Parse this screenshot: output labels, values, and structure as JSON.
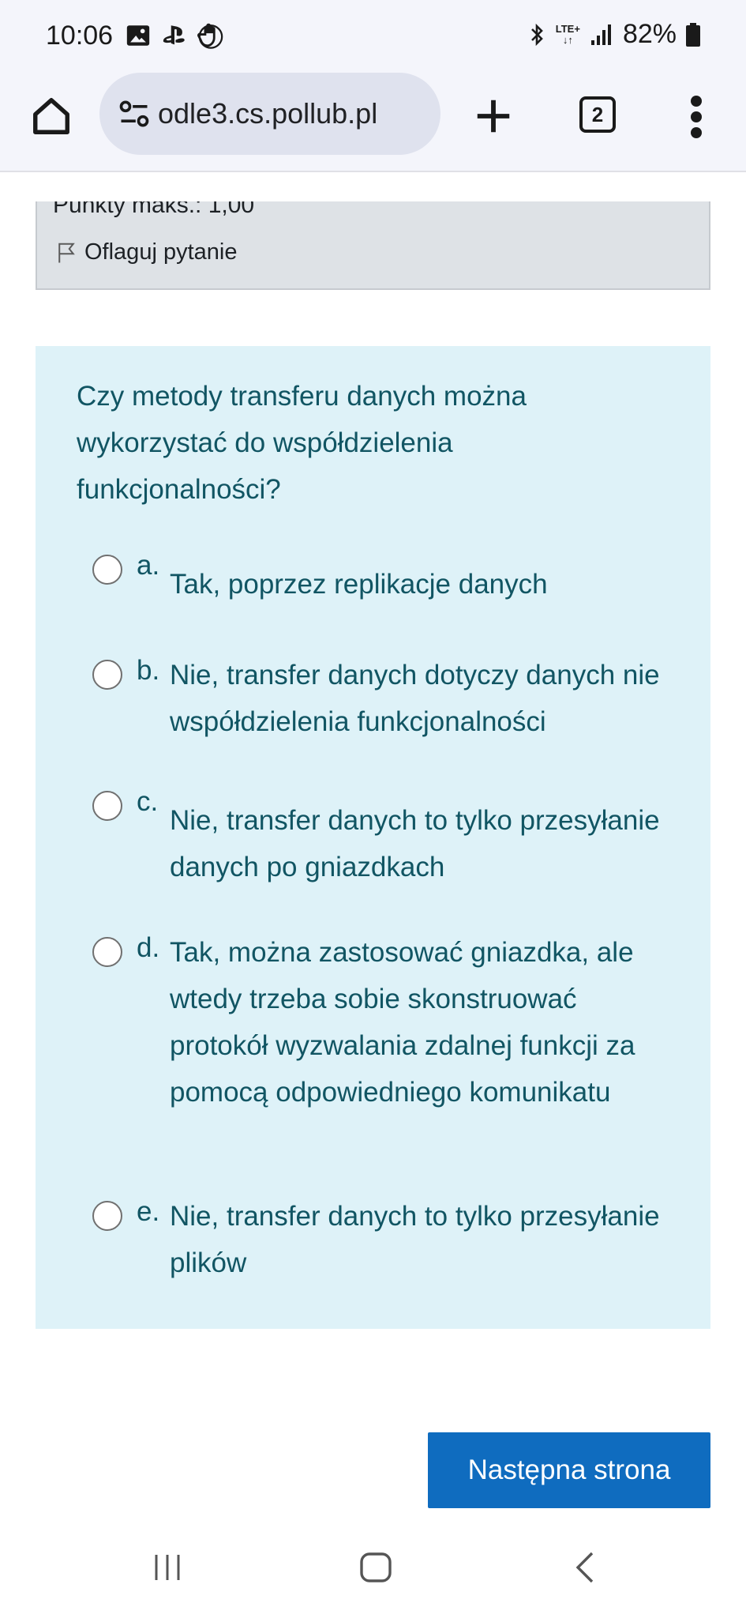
{
  "status_bar": {
    "time": "10:06",
    "left_icons": [
      "image-icon",
      "playstation-icon",
      "hand-icon"
    ],
    "network": "LTE+",
    "battery": "82%"
  },
  "browser": {
    "url": "odle3.cs.pollub.pl",
    "tab_count": "2"
  },
  "question_info": {
    "points_partial": "Punkty maks.: 1,00",
    "flag_label": "Oflaguj pytanie"
  },
  "question": {
    "text": "Czy metody transferu danych można wykorzystać do współdzielenia funkcjonalności?",
    "answers": [
      {
        "letter": "a.",
        "text": "Tak, poprzez replikacje danych"
      },
      {
        "letter": "b.",
        "text": "Nie, transfer danych dotyczy danych nie współdzielenia funkcjonalności"
      },
      {
        "letter": "c.",
        "text": "Nie, transfer danych to tylko przesyłanie danych po gniazdkach"
      },
      {
        "letter": "d.",
        "text": "Tak, można zastosować gniazdka, ale wtedy trzeba sobie skonstruować protokół wyzwalania zdalnej funkcji za pomocą odpowiedniego komunikatu"
      },
      {
        "letter": "e.",
        "text": "Nie, transfer danych to tylko przesyłanie plików"
      }
    ]
  },
  "navigation": {
    "next_label": "Następna strona"
  },
  "colors": {
    "question_bg": "#def2f8",
    "question_text": "#115563",
    "button_bg": "#0f6cbf",
    "info_bg": "#dee2e6"
  }
}
